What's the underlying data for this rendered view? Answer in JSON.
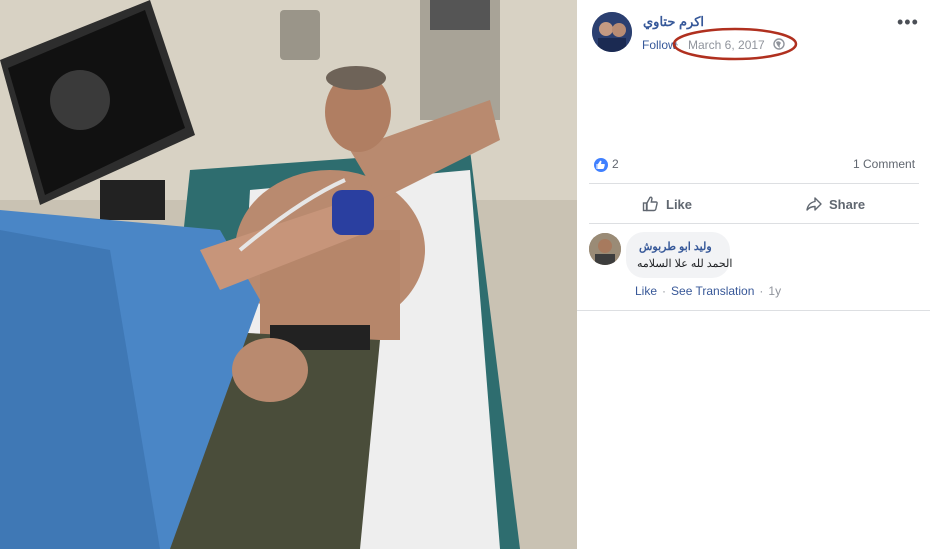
{
  "post": {
    "author": "اكرم حتاوي",
    "follow_label": "Follow",
    "separator": "·",
    "date": "March 6, 2017",
    "menu": "•••"
  },
  "stats": {
    "reactions_count": "2",
    "comments_label": "1 Comment"
  },
  "actions": {
    "like_label": "Like",
    "share_label": "Share"
  },
  "comment": {
    "author": "وليد ابو طربوش",
    "text": "الحمد لله علا السلامه",
    "like_label": "Like",
    "translate_label": "See Translation",
    "dot": "·",
    "time": "1y"
  },
  "colors": {
    "link": "#365899",
    "muted": "#90949c",
    "like_blue": "#4080ff",
    "annotation_red": "#b0301f"
  },
  "icons": {
    "globe": "globe-icon",
    "like": "thumbs-up-icon",
    "share": "share-arrow-icon",
    "more": "more-dots-icon"
  }
}
